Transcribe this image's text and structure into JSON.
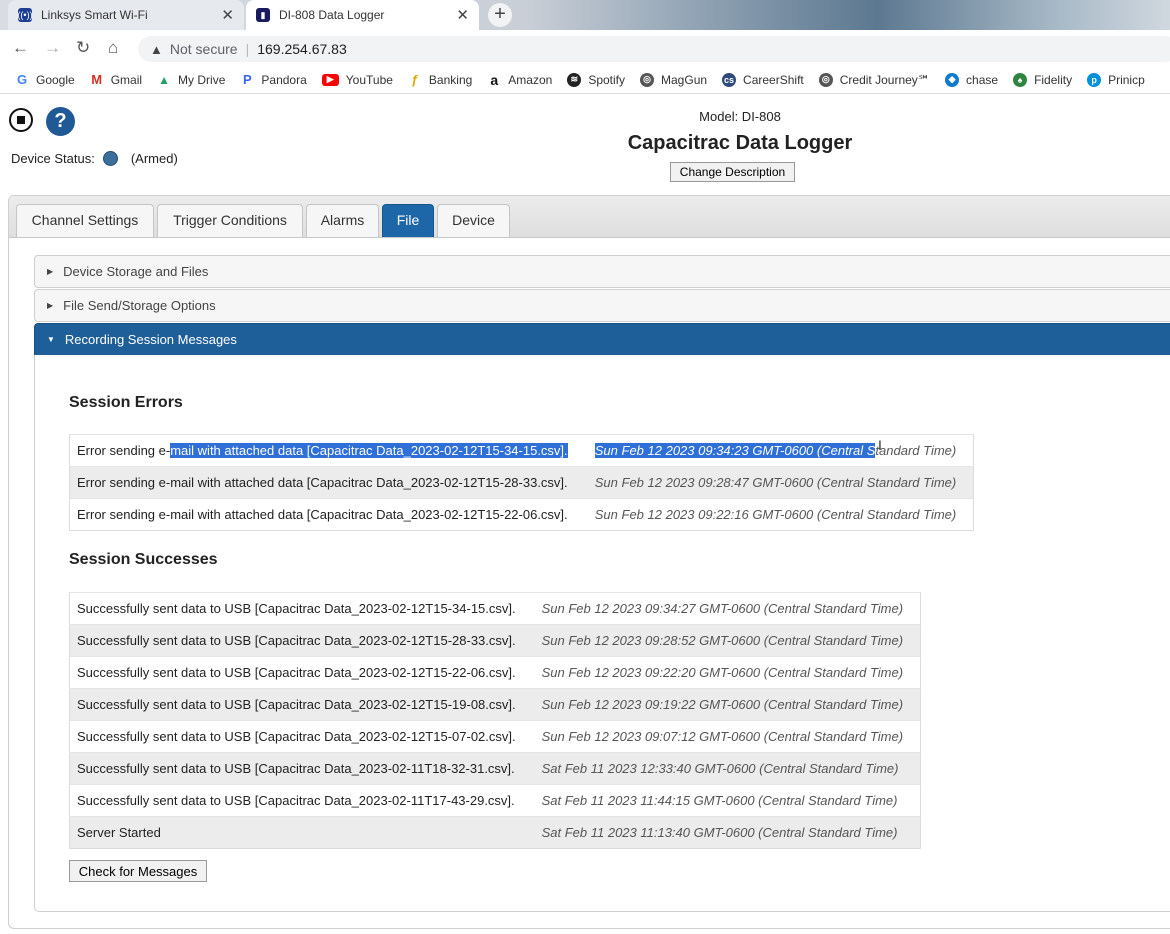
{
  "browser": {
    "tabs": [
      {
        "title": "Linksys Smart Wi-Fi",
        "active": false
      },
      {
        "title": "DI-808 Data Logger",
        "active": true
      }
    ],
    "address": {
      "security_label": "Not secure",
      "url": "169.254.67.83"
    },
    "bookmarks": [
      {
        "label": "Google",
        "icon": "google-icon",
        "color": "#4285f4"
      },
      {
        "label": "Gmail",
        "icon": "gmail-icon",
        "color": "#d93025"
      },
      {
        "label": "My Drive",
        "icon": "drive-icon",
        "color": "#1fa463"
      },
      {
        "label": "Pandora",
        "icon": "pandora-icon",
        "color": "#3668ff"
      },
      {
        "label": "YouTube",
        "icon": "youtube-icon",
        "color": "#ff0000"
      },
      {
        "label": "Banking",
        "icon": "banking-icon",
        "color": "#e0a800"
      },
      {
        "label": "Amazon",
        "icon": "amazon-icon",
        "color": "#111111"
      },
      {
        "label": "Spotify",
        "icon": "spotify-icon",
        "color": "#222222"
      },
      {
        "label": "MagGun",
        "icon": "globe-icon",
        "color": "#555555"
      },
      {
        "label": "CareerShift",
        "icon": "careershift-icon",
        "color": "#2e4a7a"
      },
      {
        "label": "Credit Journey℠",
        "icon": "globe-icon",
        "color": "#555555"
      },
      {
        "label": "chase",
        "icon": "chase-icon",
        "color": "#117aca"
      },
      {
        "label": "Fidelity",
        "icon": "fidelity-icon",
        "color": "#2e8540"
      },
      {
        "label": "Prinicp",
        "icon": "principal-icon",
        "color": "#0091da"
      }
    ]
  },
  "header": {
    "device_status_label": "Device Status:",
    "device_status_value": "(Armed)",
    "status_color": "#3c6e9c",
    "model": "Model: DI-808",
    "title": "Capacitrac Data Logger",
    "change_description_label": "Change Description"
  },
  "tabs": [
    "Channel Settings",
    "Trigger Conditions",
    "Alarms",
    "File",
    "Device"
  ],
  "active_tab": "File",
  "accordion": [
    {
      "label": "Device Storage and Files",
      "open": false
    },
    {
      "label": "File Send/Storage Options",
      "open": false
    },
    {
      "label": "Recording Session Messages",
      "open": true
    }
  ],
  "session_errors": {
    "heading": "Session Errors",
    "rows": [
      {
        "prefix": "Error sending e-",
        "highlighted": "mail with attached data [Capacitrac Data_2023-02-12T15-34-15.csv].",
        "time_highlighted": "Sun Feb 12 2023 09:34:23 GMT-0600 (Central S",
        "time_rest": "tandard Time)"
      },
      {
        "message": "Error sending e-mail with attached data [Capacitrac Data_2023-02-12T15-28-33.csv].",
        "time": "Sun Feb 12 2023 09:28:47 GMT-0600 (Central Standard Time)"
      },
      {
        "message": "Error sending e-mail with attached data [Capacitrac Data_2023-02-12T15-22-06.csv].",
        "time": "Sun Feb 12 2023 09:22:16 GMT-0600 (Central Standard Time)"
      }
    ]
  },
  "session_successes": {
    "heading": "Session Successes",
    "rows": [
      {
        "message": "Successfully sent data to USB [Capacitrac Data_2023-02-12T15-34-15.csv].",
        "time": "Sun Feb 12 2023 09:34:27 GMT-0600 (Central Standard Time)"
      },
      {
        "message": "Successfully sent data to USB [Capacitrac Data_2023-02-12T15-28-33.csv].",
        "time": "Sun Feb 12 2023 09:28:52 GMT-0600 (Central Standard Time)"
      },
      {
        "message": "Successfully sent data to USB [Capacitrac Data_2023-02-12T15-22-06.csv].",
        "time": "Sun Feb 12 2023 09:22:20 GMT-0600 (Central Standard Time)"
      },
      {
        "message": "Successfully sent data to USB [Capacitrac Data_2023-02-12T15-19-08.csv].",
        "time": "Sun Feb 12 2023 09:19:22 GMT-0600 (Central Standard Time)"
      },
      {
        "message": "Successfully sent data to USB [Capacitrac Data_2023-02-12T15-07-02.csv].",
        "time": "Sun Feb 12 2023 09:07:12 GMT-0600 (Central Standard Time)"
      },
      {
        "message": "Successfully sent data to USB [Capacitrac Data_2023-02-11T18-32-31.csv].",
        "time": "Sat Feb 11 2023 12:33:40 GMT-0600 (Central Standard Time)"
      },
      {
        "message": "Successfully sent data to USB [Capacitrac Data_2023-02-11T17-43-29.csv].",
        "time": "Sat Feb 11 2023 11:44:15 GMT-0600 (Central Standard Time)"
      },
      {
        "message": "Server Started",
        "time": "Sat Feb 11 2023 11:13:40 GMT-0600 (Central Standard Time)"
      }
    ]
  },
  "check_messages_label": "Check for Messages",
  "colors": {
    "accent": "#1d66a8",
    "selection": "#2f6fd8"
  }
}
